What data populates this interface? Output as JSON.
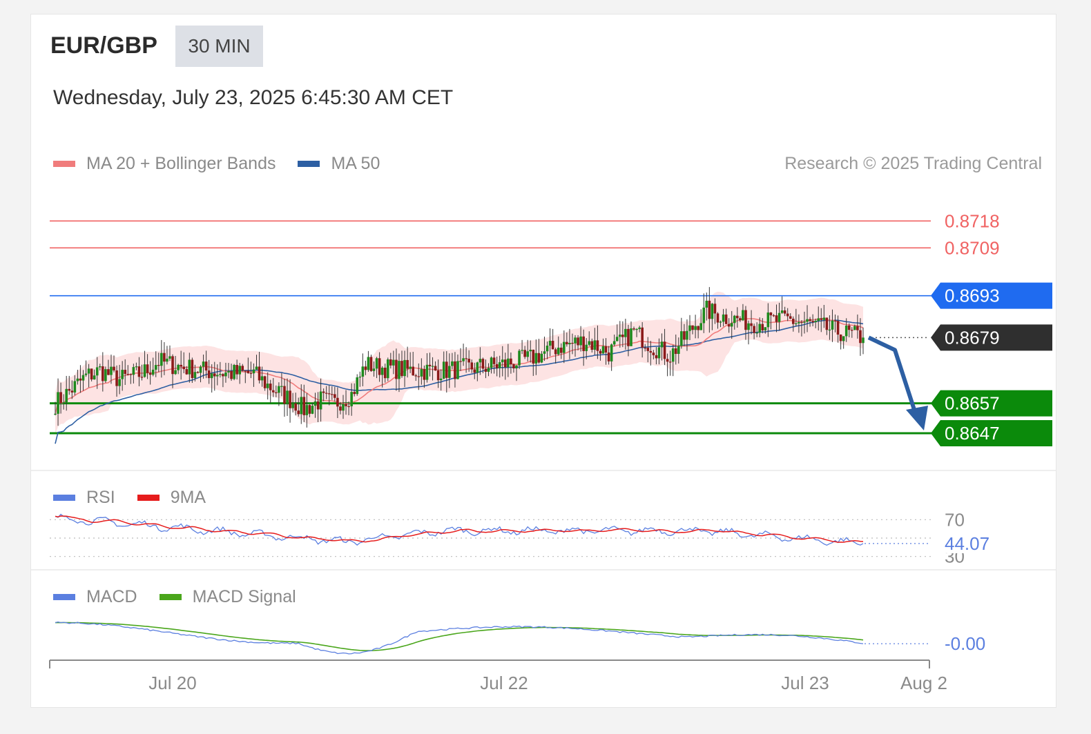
{
  "header": {
    "symbol": "EUR/GBP",
    "timeframe": "30 MIN",
    "datetime": "Wednesday, July 23, 2025 6:45:30 AM CET"
  },
  "legend_main": [
    {
      "label": "MA 20 + Bollinger Bands",
      "color": "#f07c7c"
    },
    {
      "label": "MA 50",
      "color": "#2d5fa3"
    }
  ],
  "copyright": "Research © 2025 Trading Central",
  "legend_rsi": [
    {
      "label": "RSI",
      "color": "#5b7fe0"
    },
    {
      "label": "9MA",
      "color": "#e61c1c"
    }
  ],
  "legend_macd": [
    {
      "label": "MACD",
      "color": "#5b7fe0"
    },
    {
      "label": "MACD Signal",
      "color": "#4aa61b"
    }
  ],
  "chart_data": [
    {
      "type": "candlestick",
      "title": "EUR/GBP",
      "x_ticks": [
        "Jul 20",
        "Jul 22",
        "Jul 23",
        "Aug 2"
      ],
      "ylim": [
        0.8641,
        0.8725
      ],
      "levels": [
        {
          "value": 0.8718,
          "label": "0.8718",
          "kind": "resistance",
          "color": "#f06262"
        },
        {
          "value": 0.8709,
          "label": "0.8709",
          "kind": "resistance",
          "color": "#f06262"
        },
        {
          "value": 0.8693,
          "label": "0.8693",
          "kind": "pivot",
          "color": "#1f6bf0"
        },
        {
          "value": 0.8679,
          "label": "0.8679",
          "kind": "last-price",
          "color": "#2f2f2f"
        },
        {
          "value": 0.8657,
          "label": "0.8657",
          "kind": "support",
          "color": "#0b8a0b"
        },
        {
          "value": 0.8647,
          "label": "0.8647",
          "kind": "support",
          "color": "#0b8a0b"
        }
      ],
      "candle_colors": {
        "up": "#1e8a1e",
        "down": "#8b1a1a"
      },
      "close_anchors": [
        [
          0,
          0.8657
        ],
        [
          5,
          0.8661
        ],
        [
          11,
          0.8666
        ],
        [
          16,
          0.8668
        ],
        [
          23,
          0.8665
        ],
        [
          31,
          0.8667
        ],
        [
          37,
          0.8671
        ],
        [
          46,
          0.8669
        ],
        [
          53,
          0.8668
        ],
        [
          62,
          0.8667
        ],
        [
          71,
          0.8667
        ],
        [
          76,
          0.8663
        ],
        [
          83,
          0.8659
        ],
        [
          89,
          0.8655
        ],
        [
          95,
          0.8658
        ],
        [
          100,
          0.8657
        ],
        [
          106,
          0.866
        ],
        [
          111,
          0.867
        ],
        [
          117,
          0.8669
        ],
        [
          127,
          0.8668
        ],
        [
          139,
          0.8668
        ],
        [
          150,
          0.8669
        ],
        [
          160,
          0.867
        ],
        [
          170,
          0.8672
        ],
        [
          180,
          0.8676
        ],
        [
          190,
          0.8678
        ],
        [
          198,
          0.8674
        ],
        [
          207,
          0.8681
        ],
        [
          214,
          0.8676
        ],
        [
          220,
          0.8673
        ],
        [
          226,
          0.868
        ],
        [
          233,
          0.8688
        ],
        [
          239,
          0.8686
        ],
        [
          250,
          0.8684
        ],
        [
          262,
          0.8685
        ],
        [
          272,
          0.8683
        ],
        [
          280,
          0.8681
        ],
        [
          289,
          0.8679
        ]
      ],
      "n_candles": 290,
      "ma20_end": 0.8683,
      "ma50_end": 0.8681,
      "forecast": {
        "from": 0.8679,
        "to": 0.8647
      }
    },
    {
      "type": "line",
      "name": "RSI",
      "reference_lines": [
        70,
        50,
        30
      ],
      "tick_labels": [
        "70",
        "30"
      ],
      "last_value": 44.07,
      "last_label": "44.07",
      "series": [
        {
          "name": "RSI",
          "color": "#5b7fe0"
        },
        {
          "name": "9MA",
          "color": "#e61c1c"
        }
      ]
    },
    {
      "type": "line",
      "name": "MACD",
      "last_label": "-0.00",
      "series": [
        {
          "name": "MACD",
          "color": "#5b7fe0"
        },
        {
          "name": "MACD Signal",
          "color": "#4aa61b"
        }
      ]
    }
  ]
}
